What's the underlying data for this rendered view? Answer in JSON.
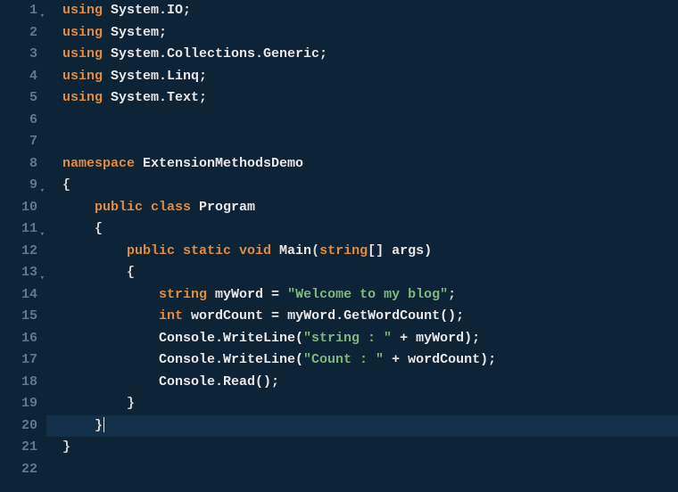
{
  "lines": [
    {
      "num": "1",
      "fold": true,
      "tokens": [
        {
          "t": "using ",
          "c": "kw"
        },
        {
          "t": "System.IO;",
          "c": "ident"
        }
      ]
    },
    {
      "num": "2",
      "fold": false,
      "tokens": [
        {
          "t": "using ",
          "c": "kw"
        },
        {
          "t": "System;",
          "c": "ident"
        }
      ]
    },
    {
      "num": "3",
      "fold": false,
      "tokens": [
        {
          "t": "using ",
          "c": "kw"
        },
        {
          "t": "System.Collections.Generic;",
          "c": "ident"
        }
      ]
    },
    {
      "num": "4",
      "fold": false,
      "tokens": [
        {
          "t": "using ",
          "c": "kw"
        },
        {
          "t": "System.Linq;",
          "c": "ident"
        }
      ]
    },
    {
      "num": "5",
      "fold": false,
      "tokens": [
        {
          "t": "using ",
          "c": "kw"
        },
        {
          "t": "System.Text;",
          "c": "ident"
        }
      ]
    },
    {
      "num": "6",
      "fold": false,
      "tokens": []
    },
    {
      "num": "7",
      "fold": false,
      "tokens": []
    },
    {
      "num": "8",
      "fold": false,
      "tokens": [
        {
          "t": "namespace ",
          "c": "kw"
        },
        {
          "t": "ExtensionMethodsDemo",
          "c": "ident"
        }
      ]
    },
    {
      "num": "9",
      "fold": true,
      "tokens": [
        {
          "t": "{",
          "c": "punct"
        }
      ]
    },
    {
      "num": "10",
      "fold": false,
      "tokens": [
        {
          "t": "    ",
          "c": ""
        },
        {
          "t": "public class ",
          "c": "kw"
        },
        {
          "t": "Program",
          "c": "ident"
        }
      ]
    },
    {
      "num": "11",
      "fold": true,
      "tokens": [
        {
          "t": "    {",
          "c": "punct"
        }
      ]
    },
    {
      "num": "12",
      "fold": false,
      "tokens": [
        {
          "t": "        ",
          "c": ""
        },
        {
          "t": "public static void ",
          "c": "kw"
        },
        {
          "t": "Main",
          "c": "ident"
        },
        {
          "t": "(",
          "c": "punct"
        },
        {
          "t": "string",
          "c": "kw"
        },
        {
          "t": "[] args)",
          "c": "ident"
        }
      ]
    },
    {
      "num": "13",
      "fold": true,
      "tokens": [
        {
          "t": "        {",
          "c": "punct"
        }
      ]
    },
    {
      "num": "14",
      "fold": false,
      "tokens": [
        {
          "t": "            ",
          "c": ""
        },
        {
          "t": "string ",
          "c": "kw"
        },
        {
          "t": "myWord = ",
          "c": "ident"
        },
        {
          "t": "\"Welcome to my blog\"",
          "c": "str"
        },
        {
          "t": ";",
          "c": "punct"
        }
      ]
    },
    {
      "num": "15",
      "fold": false,
      "tokens": [
        {
          "t": "            ",
          "c": ""
        },
        {
          "t": "int ",
          "c": "kw"
        },
        {
          "t": "wordCount = myWord.GetWordCount();",
          "c": "ident"
        }
      ]
    },
    {
      "num": "16",
      "fold": false,
      "tokens": [
        {
          "t": "            Console.WriteLine(",
          "c": "ident"
        },
        {
          "t": "\"string : \"",
          "c": "str"
        },
        {
          "t": " + myWord);",
          "c": "ident"
        }
      ]
    },
    {
      "num": "17",
      "fold": false,
      "tokens": [
        {
          "t": "            Console.WriteLine(",
          "c": "ident"
        },
        {
          "t": "\"Count : \"",
          "c": "str"
        },
        {
          "t": " + wordCount);",
          "c": "ident"
        }
      ]
    },
    {
      "num": "18",
      "fold": false,
      "tokens": [
        {
          "t": "            Console.Read();",
          "c": "ident"
        }
      ]
    },
    {
      "num": "19",
      "fold": false,
      "tokens": [
        {
          "t": "        }",
          "c": "punct"
        }
      ]
    },
    {
      "num": "20",
      "fold": false,
      "active": true,
      "cursor": true,
      "tokens": [
        {
          "t": "    }",
          "c": "punct"
        }
      ]
    },
    {
      "num": "21",
      "fold": false,
      "tokens": [
        {
          "t": "}",
          "c": "punct"
        }
      ]
    },
    {
      "num": "22",
      "fold": false,
      "tokens": []
    }
  ],
  "fold_glyph": "▾"
}
